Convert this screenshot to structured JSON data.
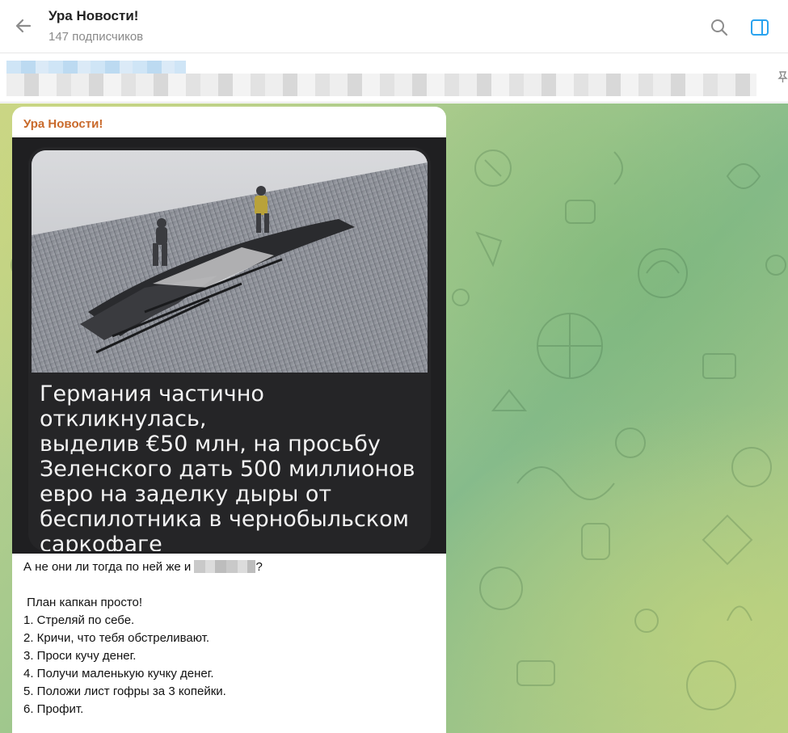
{
  "header": {
    "title": "Ура Новости!",
    "subtitle": "147 подписчиков"
  },
  "icons": {
    "back": "arrow-left-icon",
    "search": "search-icon",
    "panel": "sidebar-toggle-icon",
    "pin": "pin-icon"
  },
  "colors": {
    "channel_name": "#c9692a",
    "accent_blue": "#2aa3ef"
  },
  "message": {
    "channel_name": "Ура Новости!",
    "image_headline_lines": [
      "Германия частично откликнулась,",
      "выделив  €50 млн, на просьбу",
      "Зеленского дать 500 миллионов",
      "евро на заделку дыры от",
      "беспилотника в чернобыльском",
      "саркофаге"
    ],
    "intro_before": "А не они ли тогда по ней же и ",
    "intro_after": "?",
    "plan_title": " План капкан просто!",
    "steps": [
      "1. Стреляй по себе.",
      "2. Кричи, что тебя обстреливают.",
      "3. Проси кучу денег.",
      "4. Получи маленькую кучку денег.",
      "5. Положи лист гофры за 3 копейки.",
      "6. Профит."
    ]
  }
}
